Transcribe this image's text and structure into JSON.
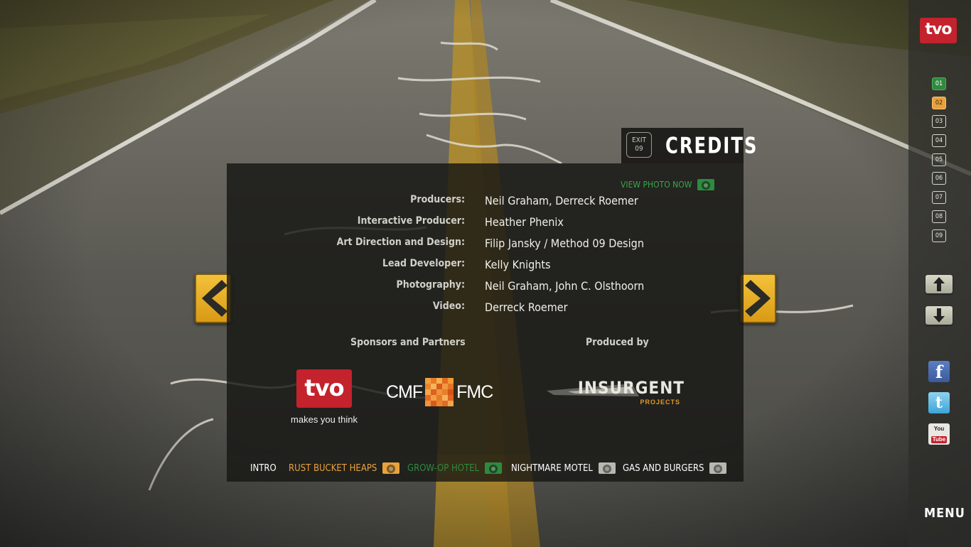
{
  "sidebar": {
    "logo": "tvo",
    "pages": [
      {
        "label": "01",
        "state": "done"
      },
      {
        "label": "02",
        "state": "current"
      },
      {
        "label": "03",
        "state": "todo"
      },
      {
        "label": "04",
        "state": "todo"
      },
      {
        "label": "05",
        "state": "todo"
      },
      {
        "label": "06",
        "state": "todo"
      },
      {
        "label": "07",
        "state": "todo"
      },
      {
        "label": "08",
        "state": "todo"
      },
      {
        "label": "09",
        "state": "todo"
      }
    ],
    "social": {
      "facebook": "f",
      "twitter": "t",
      "youtube_you": "You",
      "youtube_tube": "Tube"
    },
    "menu_label": "MENU"
  },
  "header": {
    "exit_line1": "EXIT",
    "exit_line2": "09",
    "title": "CREDITS"
  },
  "panel": {
    "view_photo_label": "VIEW PHOTO NOW",
    "credits": [
      {
        "role": "Producers:",
        "name": "Neil Graham, Derreck Roemer"
      },
      {
        "role": "Interactive Producer:",
        "name": "Heather Phenix"
      },
      {
        "role": "Art Direction and Design:",
        "name": "Filip Jansky / Method 09 Design"
      },
      {
        "role": "Lead Developer:",
        "name": "Kelly Knights"
      },
      {
        "role": "Photography:",
        "name": "Neil Graham, John C. Olsthoorn"
      },
      {
        "role": "Video:",
        "name": "Derreck Roemer"
      }
    ],
    "sponsors_heading": "Sponsors and Partners",
    "produced_by_heading": "Produced by",
    "tvo_logo": "tvo",
    "tvo_tagline": "makes you think",
    "cmf_left": "CMF",
    "cmf_right": "FMC",
    "insurgent_text": "INSURGENT",
    "insurgent_sub": "PROJECTS"
  },
  "bottom_nav": [
    {
      "label": "INTRO",
      "color": "#ffffff",
      "has_camera": false
    },
    {
      "label": "RUST BUCKET HEAPS",
      "color": "#e8a23c",
      "has_camera": true
    },
    {
      "label": "GROW-OP HOTEL",
      "color": "#2f8a3e",
      "has_camera": true
    },
    {
      "label": "NIGHTMARE MOTEL",
      "color": "#ffffff",
      "has_camera": true
    },
    {
      "label": "GAS AND BURGERS",
      "color": "#ffffff",
      "has_camera": true
    }
  ],
  "colors": {
    "accent_green": "#2f8a3e",
    "accent_orange": "#e8a23c",
    "tvo_red": "#c4222d",
    "sign_yellow": "#f3c23a"
  },
  "icons": {
    "prev": "chevron-left-icon",
    "next": "chevron-right-icon",
    "up": "arrow-up-icon",
    "down": "arrow-down-icon",
    "camera": "camera-icon"
  }
}
